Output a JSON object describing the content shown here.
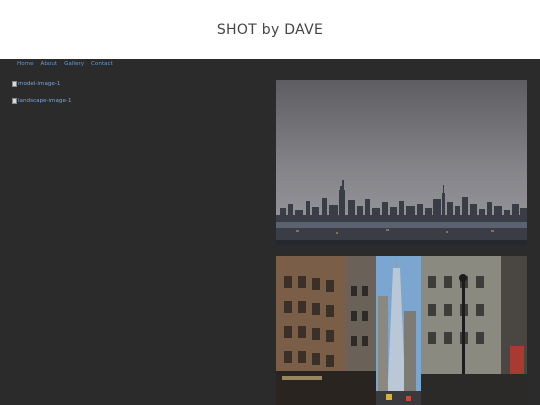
{
  "site": {
    "title": "SHOT by DAVE"
  },
  "nav": {
    "items": [
      "Home",
      "About",
      "Gallery",
      "Contact"
    ]
  },
  "images": {
    "model_alt": "model-image-1",
    "landscape_alt": "landscape-image-1"
  },
  "colors": {
    "header_bg": "#ffffff",
    "page_bg": "#2b2b2b",
    "link": "#5b9bd5"
  }
}
